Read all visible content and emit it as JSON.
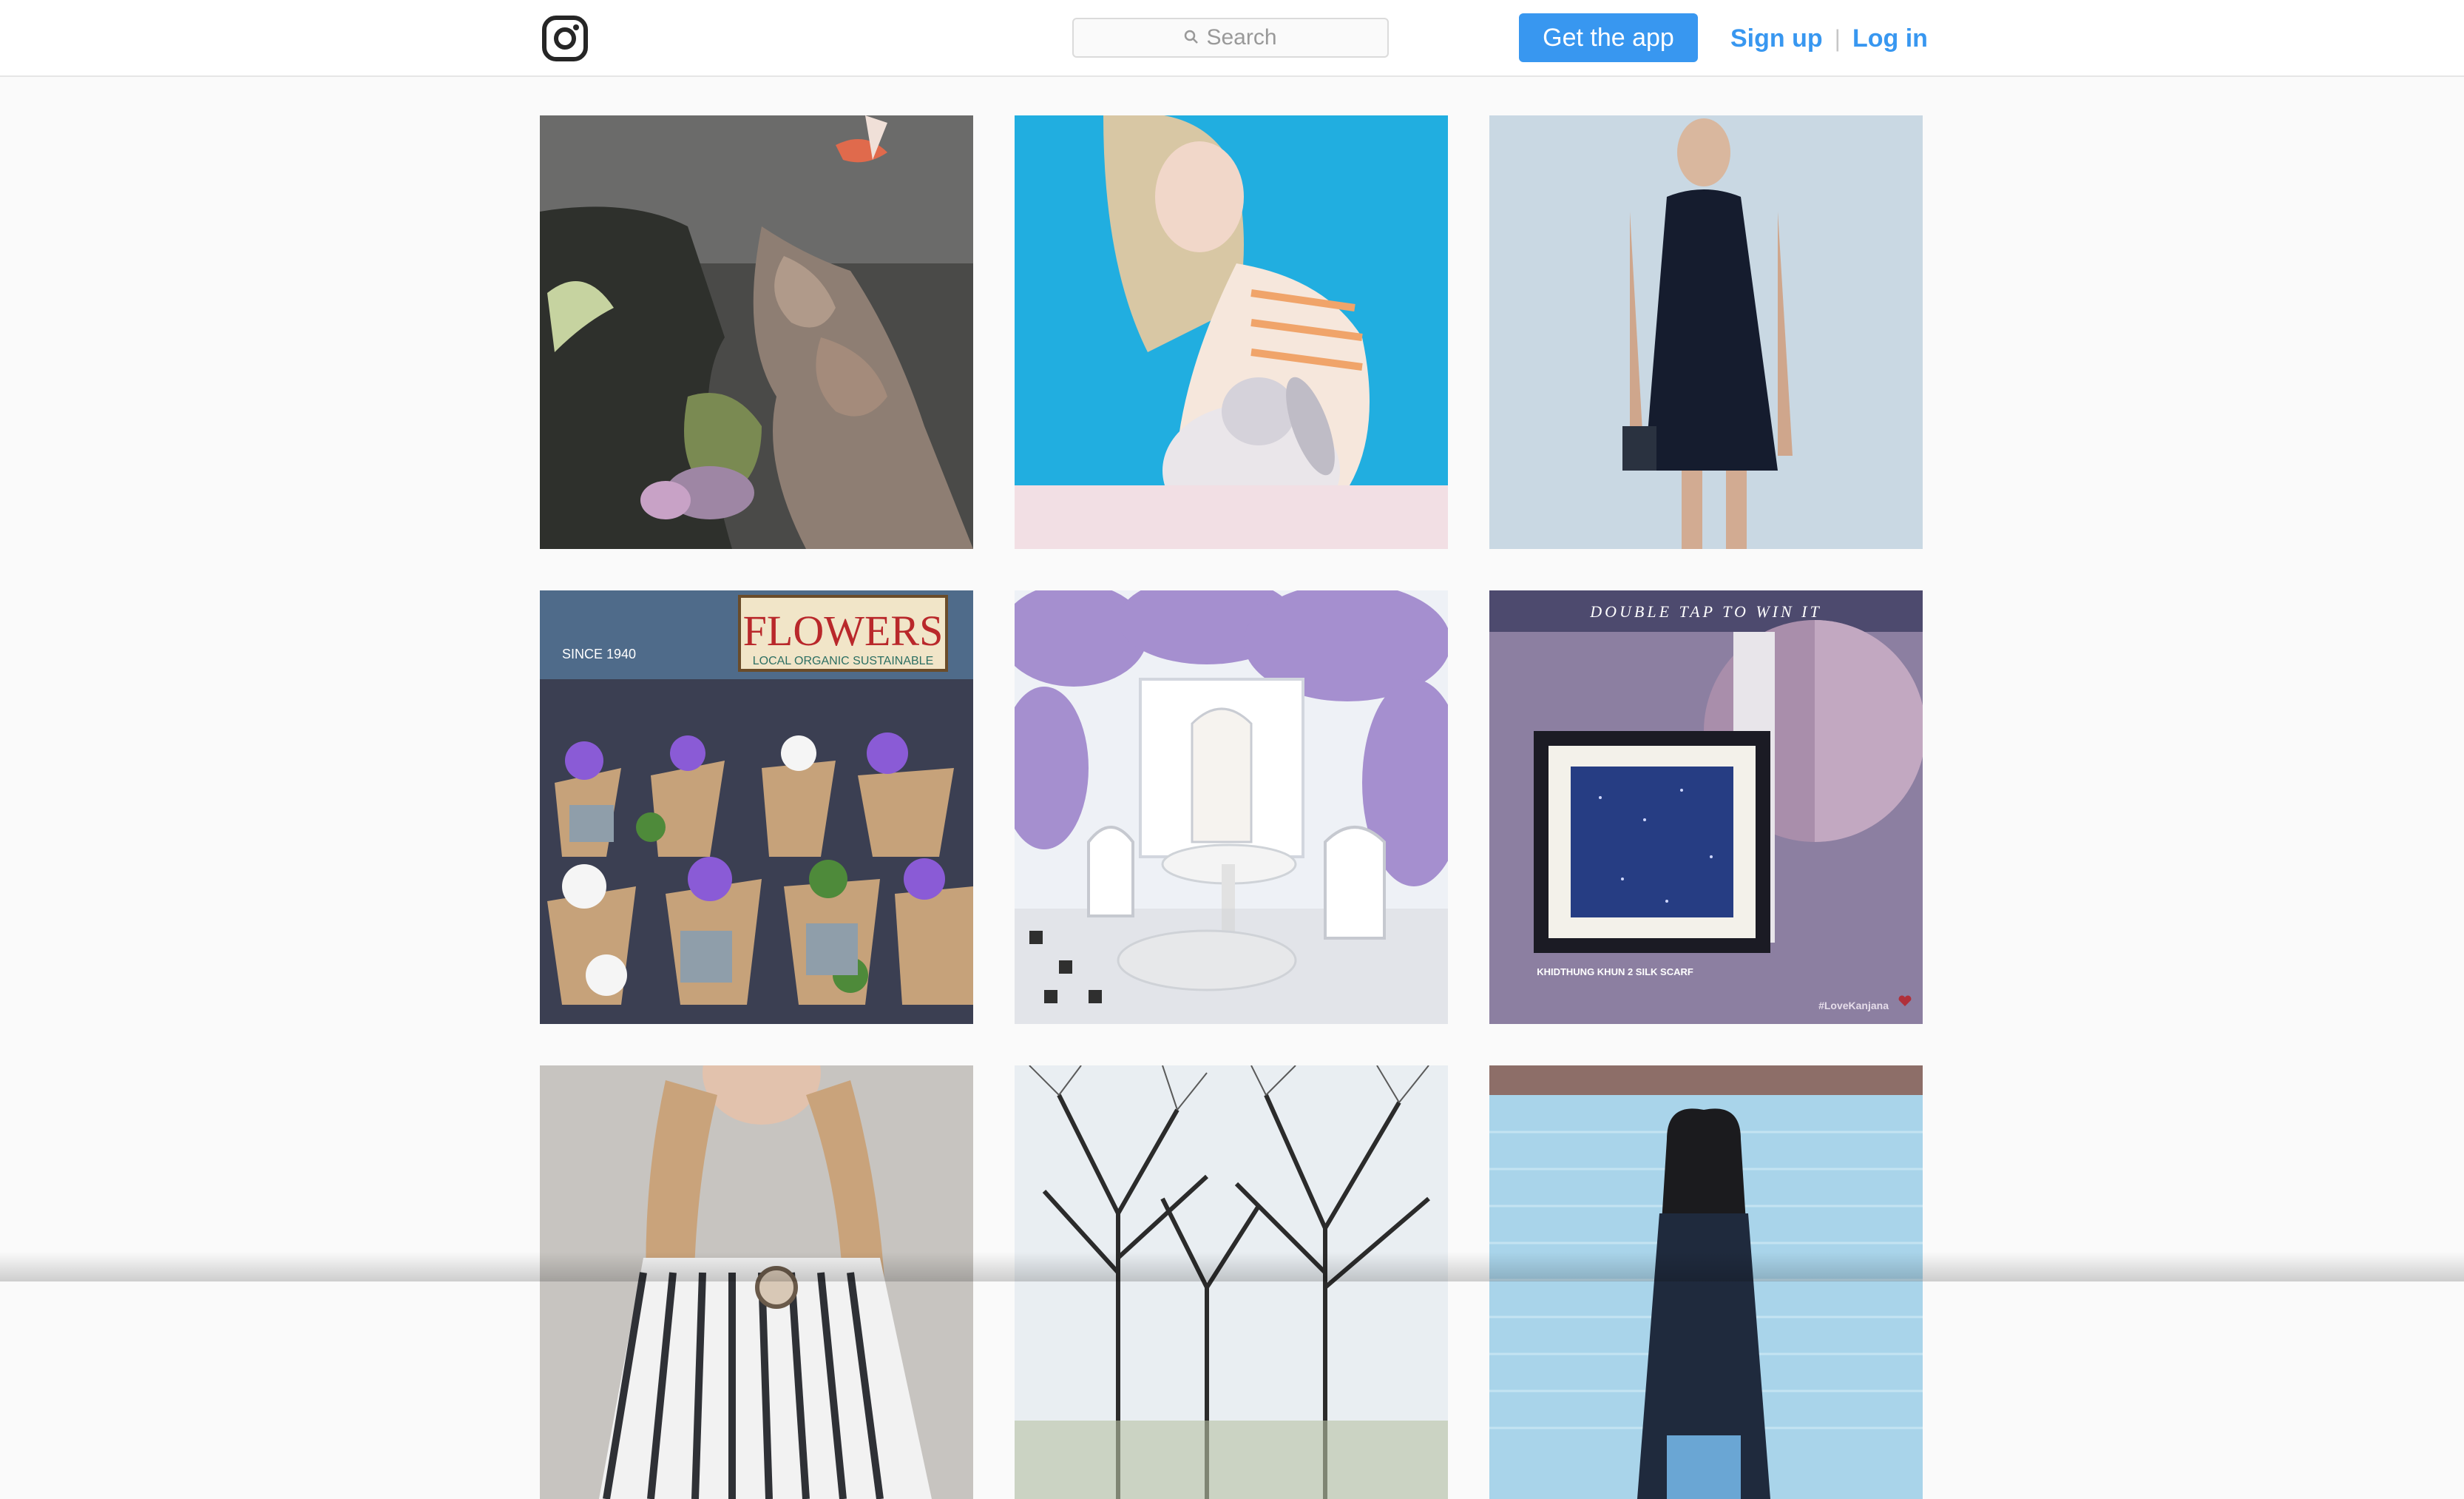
{
  "header": {
    "logo_icon": "instagram-logo-icon",
    "search": {
      "icon": "search-icon",
      "placeholder": "Search"
    },
    "get_app_label": "Get the app",
    "signup_label": "Sign up",
    "separator": "|",
    "login_label": "Log in"
  },
  "colors": {
    "accent": "#3897f0",
    "background": "#fafafa",
    "header_border": "#e6e6e6"
  },
  "grid": {
    "rows": 3,
    "columns": 3,
    "tiles": [
      {
        "name": "post-koi-pond"
      },
      {
        "name": "post-woman-with-rabbit"
      },
      {
        "name": "post-woman-in-black-dress"
      },
      {
        "name": "post-flower-market"
      },
      {
        "name": "post-wisteria-cafe"
      },
      {
        "name": "post-silk-scarf-ad",
        "banner": "DOUBLE TAP TO WIN IT",
        "caption": "KHIDTHUNG KHUN 2 SILK SCARF",
        "hashtag": "#LoveKanjana",
        "sign_text": "FLOWERS",
        "sign_sub": "LOCAL ORGANIC SUSTAINABLE",
        "since_text": "SINCE 1940"
      },
      {
        "name": "post-striped-blouse"
      },
      {
        "name": "post-bare-trees"
      },
      {
        "name": "post-woman-brick-wall"
      }
    ]
  },
  "tile_texts": {
    "flower_sign": "FLOWERS",
    "flower_sign_sub": "LOCAL ORGANIC SUSTAINABLE",
    "flower_since": "SINCE 1940",
    "scarf_banner": "DOUBLE TAP TO WIN IT",
    "scarf_caption": "KHIDTHUNG KHUN 2 SILK SCARF",
    "scarf_hashtag": "#LoveKanjana"
  }
}
